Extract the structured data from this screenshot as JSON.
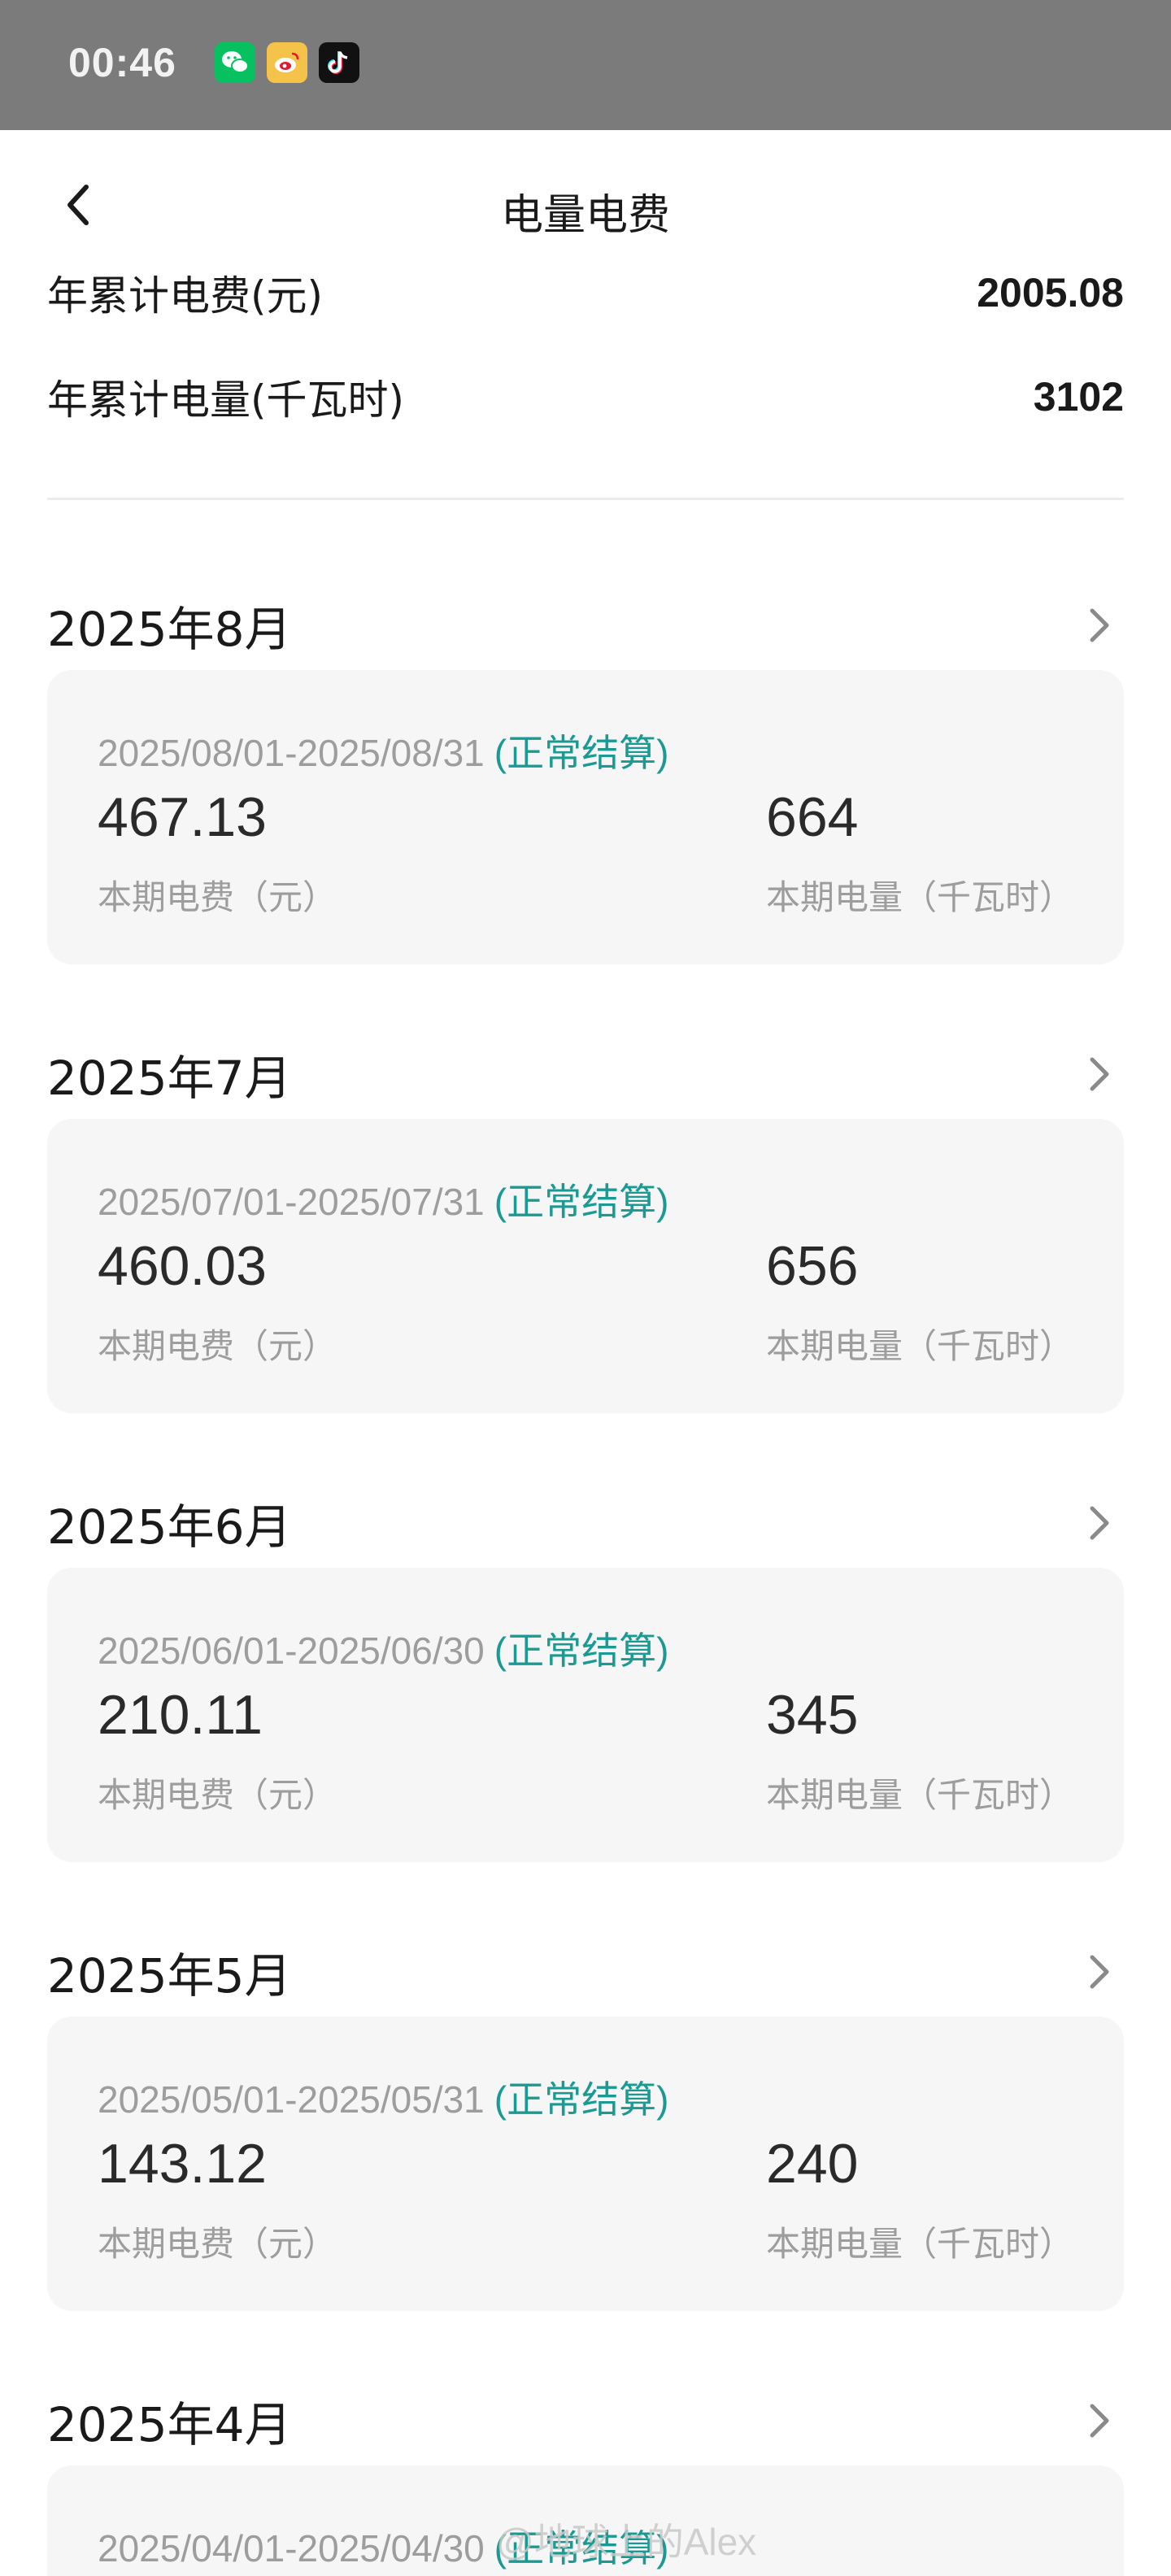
{
  "status_bar": {
    "time": "00:46",
    "apps": [
      "wechat-icon",
      "weibo-icon",
      "douyin-icon"
    ]
  },
  "nav": {
    "title": "电量电费",
    "back_icon": "chevron-left-icon"
  },
  "summary": {
    "fee_label": "年累计电费(元)",
    "fee_value": "2005.08",
    "usage_label": "年累计电量(千瓦时)",
    "usage_value": "3102"
  },
  "months": [
    {
      "title": "2025年8月",
      "period": "2025/08/01-2025/08/31",
      "status": "(正常结算)",
      "fee": "467.13",
      "fee_label": "本期电费（元）",
      "usage": "664",
      "usage_label": "本期电量（千瓦时）"
    },
    {
      "title": "2025年7月",
      "period": "2025/07/01-2025/07/31",
      "status": "(正常结算)",
      "fee": "460.03",
      "fee_label": "本期电费（元）",
      "usage": "656",
      "usage_label": "本期电量（千瓦时）"
    },
    {
      "title": "2025年6月",
      "period": "2025/06/01-2025/06/30",
      "status": "(正常结算)",
      "fee": "210.11",
      "fee_label": "本期电费（元）",
      "usage": "345",
      "usage_label": "本期电量（千瓦时）"
    },
    {
      "title": "2025年5月",
      "period": "2025/05/01-2025/05/31",
      "status": "(正常结算)",
      "fee": "143.12",
      "fee_label": "本期电费（元）",
      "usage": "240",
      "usage_label": "本期电量（千瓦时）"
    },
    {
      "title": "2025年4月",
      "period": "2025/04/01-2025/04/30",
      "status": "(正常结算)"
    }
  ],
  "watermark": "@地球上的Alex",
  "colors": {
    "status_bar": "#7b7b7b",
    "accent_teal": "#1a9a92",
    "card_bg": "#f6f6f6",
    "muted_text": "#9d9d9d"
  }
}
